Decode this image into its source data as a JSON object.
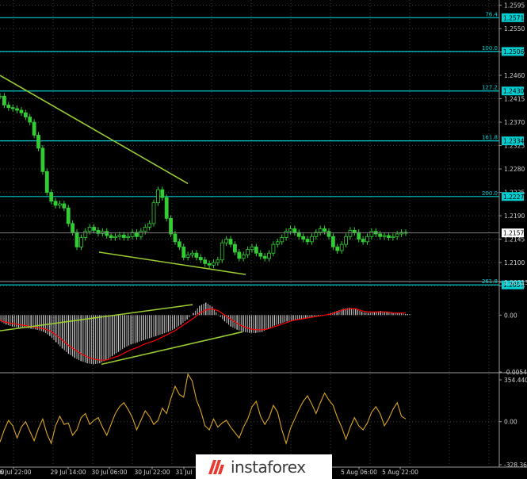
{
  "colors": {
    "background": "#000000",
    "grid": "#3a3a3a",
    "fibo": "#00ced1",
    "fibo_label_bg": "#00ced1",
    "candle": "#32cd32",
    "trendline": "#9acd32",
    "histogram": "#c8c8c8",
    "signal": "#ff0000",
    "cci": "#daa520",
    "axis_text": "#d0d0d0",
    "price_label_bg": "#ffffff"
  },
  "chart_data": [
    {
      "type": "candlestick",
      "title": "",
      "y_range": [
        1.2065,
        1.2605
      ],
      "y_ticks": [
        "1.2595",
        "1.2550",
        "1.2505",
        "1.2460",
        "1.2415",
        "1.2370",
        "1.2325",
        "1.2280",
        "1.2235",
        "1.2190",
        "1.2145",
        "1.2100",
        "1.2055"
      ],
      "fibo_levels": [
        {
          "ratio": "76.4",
          "price": "1.2571"
        },
        {
          "ratio": "100.0",
          "price": "1.2506"
        },
        {
          "ratio": "127.2",
          "price": "1.2430"
        },
        {
          "ratio": "161.8",
          "price": "1.2334"
        },
        {
          "ratio": "200.0",
          "price": "1.2227"
        },
        {
          "ratio": "261.8",
          "price": "1.2057"
        }
      ],
      "current_price": "1.2157",
      "trendlines": [
        {
          "points": [
            [
              0,
              1.246
            ],
            [
              237,
              1.2252
            ]
          ]
        },
        {
          "points": [
            [
              125,
              1.212
            ],
            [
              310,
              1.2077
            ]
          ]
        }
      ],
      "close_series": [
        1.242,
        1.2403,
        1.2398,
        1.2396,
        1.2393,
        1.2388,
        1.238,
        1.237,
        1.2345,
        1.232,
        1.2275,
        1.2235,
        1.2218,
        1.221,
        1.2213,
        1.2205,
        1.2175,
        1.2158,
        1.213,
        1.2148,
        1.216,
        1.2168,
        1.2162,
        1.2156,
        1.216,
        1.2152,
        1.2148,
        1.215,
        1.2153,
        1.2148,
        1.215,
        1.2158,
        1.215,
        1.216,
        1.2168,
        1.2175,
        1.2215,
        1.224,
        1.2225,
        1.2185,
        1.2155,
        1.214,
        1.213,
        1.211,
        1.2115,
        1.2118,
        1.211,
        1.2105,
        1.2098,
        1.2095,
        1.21,
        1.2105,
        1.2138,
        1.2145,
        1.2135,
        1.212,
        1.2108,
        1.2115,
        1.2125,
        1.213,
        1.2118,
        1.2112,
        1.2108,
        1.2118,
        1.2135,
        1.214,
        1.2148,
        1.216,
        1.2165,
        1.2158,
        1.215,
        1.2145,
        1.214,
        1.215,
        1.2158,
        1.2165,
        1.216,
        1.215,
        1.213,
        1.2123,
        1.2135,
        1.215,
        1.2162,
        1.2158,
        1.2145,
        1.214,
        1.215,
        1.216,
        1.2155,
        1.215,
        1.2152,
        1.2148,
        1.215,
        1.2155,
        1.2158,
        1.2157
      ],
      "close_series_x_span": [
        0,
        512
      ]
    },
    {
      "type": "histogram+line",
      "y_ticks": [
        "0.00313",
        "0.00",
        "-0.00543"
      ],
      "y_range": [
        -0.00543,
        0.00313
      ],
      "histogram": [
        -0.0006,
        -0.0009,
        -0.0011,
        -0.0012,
        -0.0012,
        -0.0013,
        -0.0014,
        -0.0016,
        -0.002,
        -0.0026,
        -0.0032,
        -0.0037,
        -0.0041,
        -0.0044,
        -0.0046,
        -0.0047,
        -0.0046,
        -0.0043,
        -0.0039,
        -0.0035,
        -0.0031,
        -0.0028,
        -0.0026,
        -0.0024,
        -0.0022,
        -0.002,
        -0.0018,
        -0.0016,
        -0.0013,
        -0.0009,
        -0.0004,
        0.0002,
        0.0009,
        0.0012,
        0.0008,
        0.0,
        -0.0006,
        -0.0011,
        -0.0014,
        -0.0016,
        -0.0017,
        -0.0017,
        -0.0016,
        -0.0013,
        -0.001,
        -0.0008,
        -0.0006,
        -0.0005,
        -0.0004,
        -0.0003,
        -0.0002,
        -0.0001,
        0.0,
        0.0002,
        0.0004,
        0.0006,
        0.0007,
        0.0006,
        0.0003,
        0.0002,
        0.0003,
        0.0004,
        0.0003,
        0.0002,
        0.0002,
        0.0001
      ],
      "signal": [
        -0.0005,
        -0.0007,
        -0.0008,
        -0.0009,
        -0.001,
        -0.0011,
        -0.0012,
        -0.0013,
        -0.0015,
        -0.0019,
        -0.0024,
        -0.0029,
        -0.0033,
        -0.0037,
        -0.004,
        -0.0042,
        -0.0043,
        -0.0043,
        -0.0041,
        -0.0039,
        -0.0036,
        -0.0033,
        -0.0031,
        -0.0028,
        -0.0026,
        -0.0024,
        -0.0021,
        -0.0018,
        -0.0015,
        -0.0011,
        -0.0007,
        -0.0003,
        0.0002,
        0.0005,
        0.0006,
        0.0004,
        0.0,
        -0.0004,
        -0.0008,
        -0.0011,
        -0.0013,
        -0.0014,
        -0.0014,
        -0.0013,
        -0.0011,
        -0.0009,
        -0.0007,
        -0.0005,
        -0.0004,
        -0.0003,
        -0.0002,
        -0.0001,
        0.0,
        0.0001,
        0.0003,
        0.0005,
        0.0006,
        0.0006,
        0.0004,
        0.0003,
        0.0003,
        0.0003,
        0.0003,
        0.0002,
        0.0002,
        0.0002
      ],
      "series_x_span": [
        0,
        512
      ],
      "trendlines": [
        {
          "points": [
            [
              0,
              -0.0015
            ],
            [
              243,
              0.001
            ]
          ]
        },
        {
          "points": [
            [
              128,
              -0.0047
            ],
            [
              306,
              -0.0016
            ]
          ]
        }
      ]
    },
    {
      "type": "line",
      "y_ticks": [
        "354.4409",
        "0.00",
        "-328.365"
      ],
      "y_range": [
        -328.365,
        354.4409
      ],
      "values": [
        -150,
        -60,
        10,
        -30,
        -120,
        -40,
        0,
        -70,
        -140,
        -50,
        20,
        -90,
        -160,
        -30,
        40,
        -20,
        -10,
        -100,
        -60,
        30,
        60,
        -20,
        10,
        30,
        -40,
        -100,
        -20,
        60,
        110,
        140,
        90,
        30,
        -60,
        10,
        80,
        40,
        -20,
        10,
        100,
        60,
        170,
        260,
        200,
        180,
        350,
        300,
        160,
        80,
        -30,
        -60,
        20,
        -40,
        -10,
        10,
        -40,
        -80,
        -120,
        -40,
        20,
        110,
        150,
        40,
        -20,
        30,
        120,
        70,
        -60,
        -160,
        -50,
        20,
        90,
        150,
        190,
        130,
        60,
        140,
        210,
        160,
        120,
        30,
        -40,
        -130,
        -40,
        30,
        -30,
        -60,
        -10,
        70,
        110,
        60,
        -30,
        20,
        90,
        140,
        40,
        20
      ],
      "series_x_span": [
        0,
        512
      ]
    }
  ],
  "x_ticks": [
    "26 Jul 22:00",
    "29 Jul 14:00",
    "30 Jul 06:00",
    "30 Jul 22:00",
    "31 Jul",
    "5 Aug 06:00",
    "5 Aug 22:00"
  ],
  "x_tick_first_partial": "00",
  "watermark": {
    "brand": "instaforex"
  }
}
